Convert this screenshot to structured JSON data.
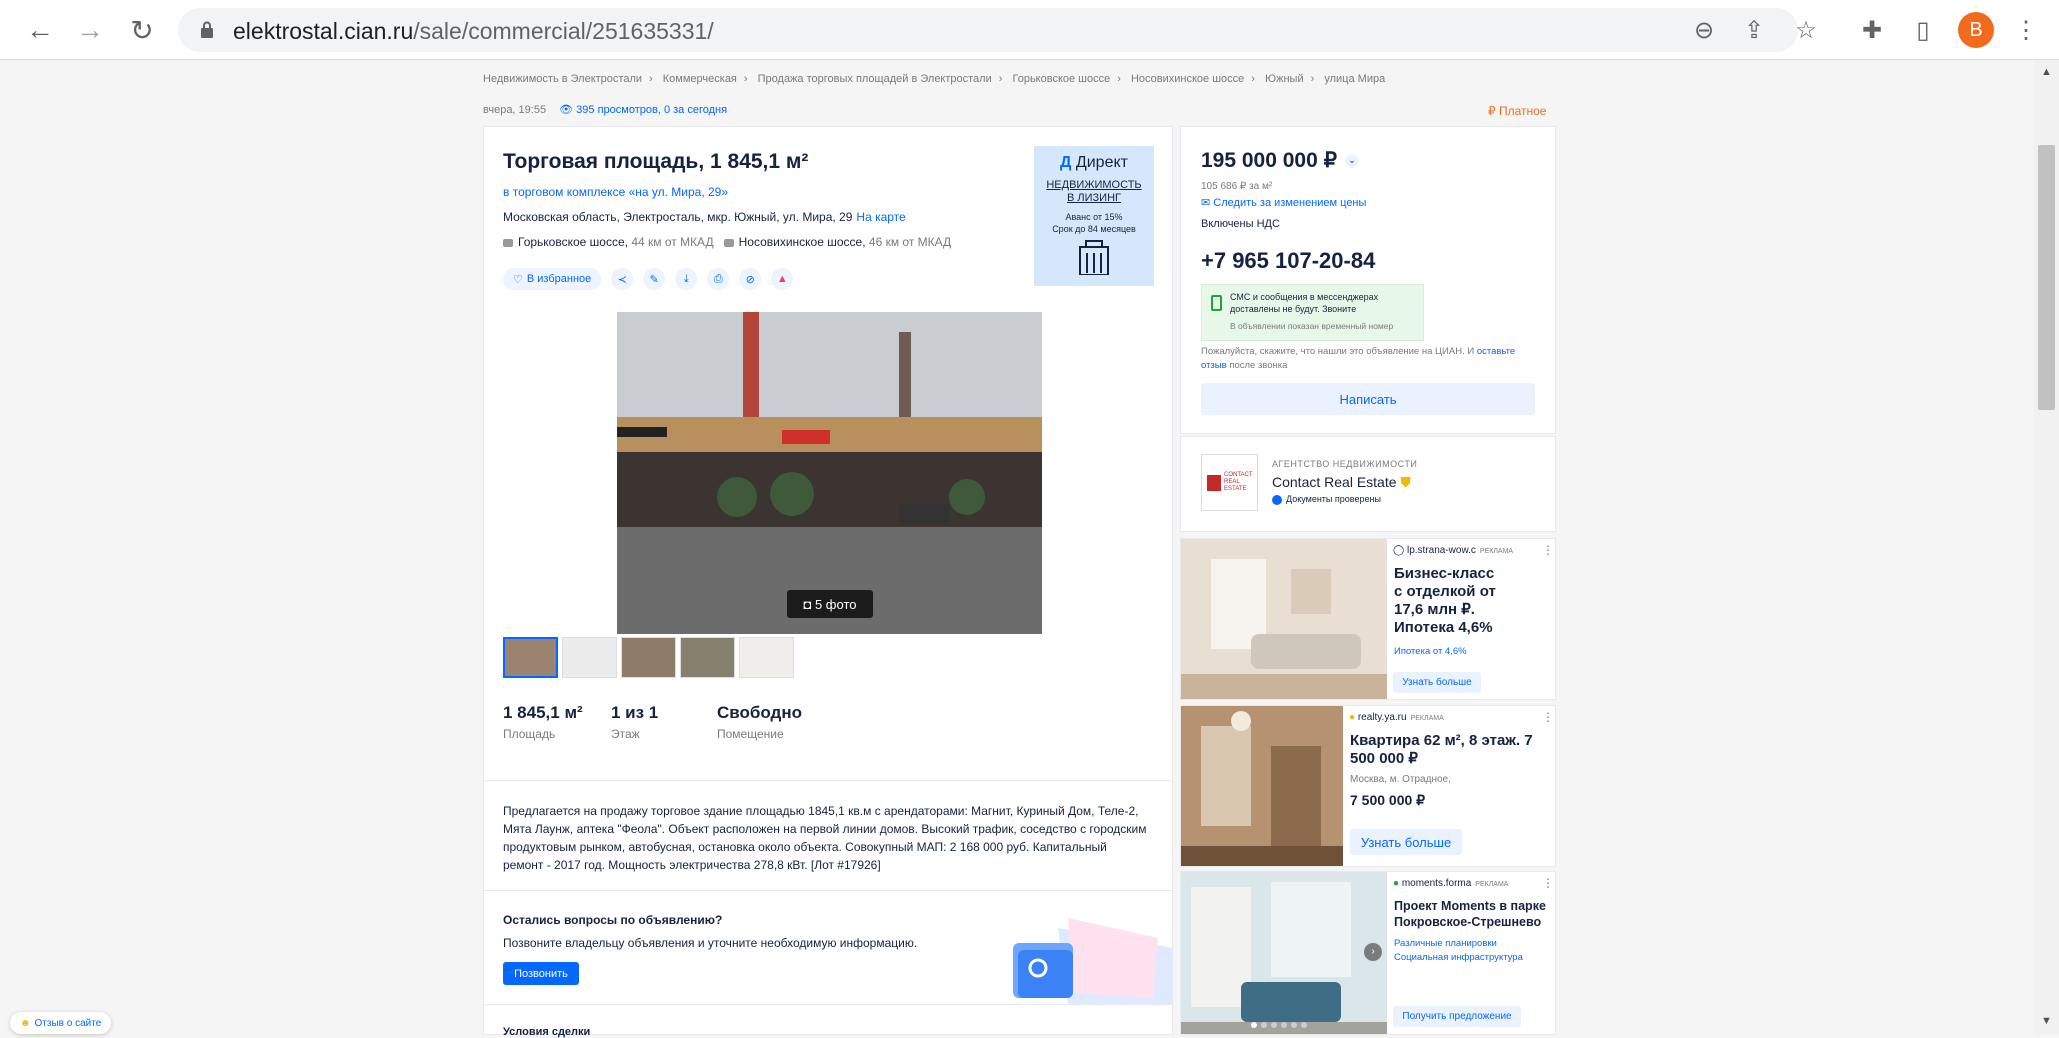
{
  "browser": {
    "url_domain": "elektrostal.cian.ru",
    "url_path": "/sale/commercial/251635331/",
    "avatar_letter": "B"
  },
  "breadcrumbs": [
    "Недвижимость в Электростали",
    "Коммерческая",
    "Продажа торговых площадей в Электростали",
    "Горьковское шоссе",
    "Носовихинское шоссе",
    "Южный",
    "улица Мира"
  ],
  "meta": {
    "time": "вчера, 19:55",
    "views": "395 просмотров, 0 за сегодня",
    "paid": "₽ Платное"
  },
  "listing": {
    "title": "Торговая площадь, 1 845,1 м²",
    "subtitle": "в торговом комплексе «на ул. Мира, 29»",
    "address": "Московская область, Электросталь, мкр. Южный, ул. Мира, 29",
    "map_link": "На карте",
    "highway1": "Горьковское шоссе,",
    "highway1_dist": "44 км от МКАД",
    "highway2": "Носовихинское шоссе,",
    "highway2_dist": "46 км от МКАД",
    "favorite": "В избранное",
    "photo_count": "5 фото",
    "stats": [
      {
        "value": "1 845,1 м²",
        "label": "Площадь"
      },
      {
        "value": "1 из 1",
        "label": "Этаж"
      },
      {
        "value": "Свободно",
        "label": "Помещение"
      }
    ],
    "description": "Предлагается на продажу торговое здание площадью 1845,1 кв.м с арендаторами: Магнит, Куриный Дом, Теле-2, Мята Лаунж, аптека \"Феола\". Объект расположен на первой линии домов. Высокий трафик, соседство с городским продуктовым рынком, автобусная, остановка около объекта. Совокупный МАП: 2 168 000 руб. Капитальный ремонт - 2017 год. Мощность электричества 278,8 кВт. [Лот #17926]",
    "questions_title": "Остались вопросы по объявлению?",
    "questions_text": "Позвоните владельцу объявления и уточните необходимую информацию.",
    "call_button": "Позвонить",
    "terms_title": "Условия сделки"
  },
  "direct_ad": {
    "logo_mark": "Д",
    "logo": "Директ",
    "line1": "НЕДВИЖИМОСТЬ",
    "line2": "В ЛИЗИНГ",
    "line3": "Аванс от 15%",
    "line4": "Срок до 84 месяцев"
  },
  "sidebar": {
    "price": "195 000 000 ₽",
    "price_per_m": "105 686 ₽ за м²",
    "follow": "Следить за изменением цены",
    "vat": "Включены НДС",
    "phone": "+7 965 107-20-84",
    "sms_title1": "СМС и сообщения в мессенджерах",
    "sms_title2": "доставлены не будут. Звоните",
    "sms_sub": "В объявлении показан временный номер",
    "note": "Пожалуйста, скажите, что нашли это объявление на ЦИАН. И",
    "note_link": "оставьте отзыв",
    "note_end": "после звонка",
    "write": "Написать",
    "agency_label": "АГЕНТСТВО НЕДВИЖИМОСТИ",
    "agency_name": "Contact Real Estate",
    "agency_verified": "Документы проверены",
    "agency_logo_text": "CONTACT REAL ESTATE"
  },
  "ads": [
    {
      "source": "lp.strana-wow.c",
      "tag": "РЕКЛАМА",
      "headline": "Бизнес-класс с отделкой от 17,6 млн ₽. Ипотека 4,6%",
      "small": "Ипотека от 4,6%",
      "button": "Узнать больше"
    },
    {
      "source": "realty.ya.ru",
      "tag": "РЕКЛАМА",
      "headline": "Квартира 62 м², 8 этаж. 7 500 000 ₽",
      "small": "Москва, м. Отрадное,",
      "price": "7 500 000 ₽",
      "button": "Узнать больше"
    },
    {
      "source": "moments.forma",
      "tag": "РЕКЛАМА",
      "headline": "Проект Moments в парке Покровское-Стрешнево",
      "small1": "Различные планировки",
      "small2": "Социальная инфраструктура",
      "button": "Получить предложение"
    }
  ],
  "feedback_site": "Отзыв о сайте"
}
